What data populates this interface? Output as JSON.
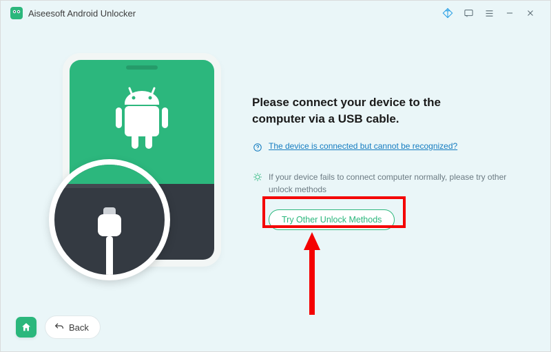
{
  "window": {
    "title": "Aiseesoft Android Unlocker"
  },
  "main": {
    "headline_line1": "Please connect your device to the",
    "headline_line2": "computer via a USB cable.",
    "link_text": "The device is connected but cannot be recognized?",
    "tip_text": "If your device fails to connect computer normally, please try other unlock methods",
    "try_button": "Try Other Unlock Methods"
  },
  "footer": {
    "back_label": "Back"
  },
  "colors": {
    "accent_green": "#2bb77c",
    "link_blue": "#147cc0",
    "annotation_red": "#f40202"
  }
}
